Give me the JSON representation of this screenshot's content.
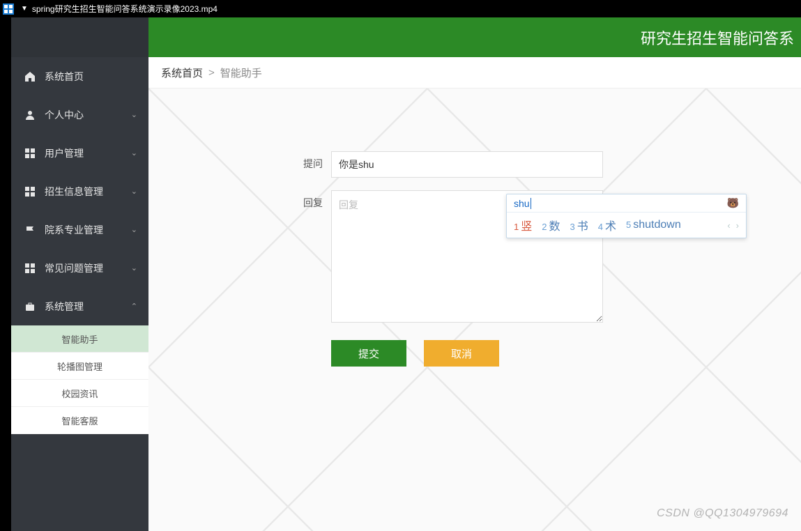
{
  "window": {
    "title": "spring研究生招生智能问答系统演示录像2023.mp4"
  },
  "header": {
    "title": "研究生招生智能问答系"
  },
  "breadcrumb": {
    "root": "系统首页",
    "sep": ">",
    "current": "智能助手"
  },
  "sidebar": {
    "items": [
      {
        "label": "系统首页",
        "icon": "home",
        "expandable": false
      },
      {
        "label": "个人中心",
        "icon": "user",
        "expandable": true,
        "open": false
      },
      {
        "label": "用户管理",
        "icon": "grid",
        "expandable": true,
        "open": false
      },
      {
        "label": "招生信息管理",
        "icon": "grid",
        "expandable": true,
        "open": false
      },
      {
        "label": "院系专业管理",
        "icon": "flag",
        "expandable": true,
        "open": false
      },
      {
        "label": "常见问题管理",
        "icon": "grid",
        "expandable": true,
        "open": false
      },
      {
        "label": "系统管理",
        "icon": "briefcase",
        "expandable": true,
        "open": true
      }
    ],
    "submenu": [
      {
        "label": "智能助手",
        "active": true
      },
      {
        "label": "轮播图管理",
        "active": false
      },
      {
        "label": "校园资讯",
        "active": false
      },
      {
        "label": "智能客服",
        "active": false
      }
    ]
  },
  "form": {
    "question_label": "提问",
    "question_value": "你是shu",
    "answer_label": "回复",
    "answer_placeholder": "回复",
    "submit": "提交",
    "cancel": "取消"
  },
  "ime": {
    "typed": "shu",
    "logo": "🐻",
    "candidates": [
      {
        "n": "1",
        "w": "竖"
      },
      {
        "n": "2",
        "w": "数"
      },
      {
        "n": "3",
        "w": "书"
      },
      {
        "n": "4",
        "w": "术"
      },
      {
        "n": "5",
        "w": "shutdown"
      }
    ],
    "prev": "‹",
    "next": "›"
  },
  "watermark": "CSDN @QQ1304979694"
}
